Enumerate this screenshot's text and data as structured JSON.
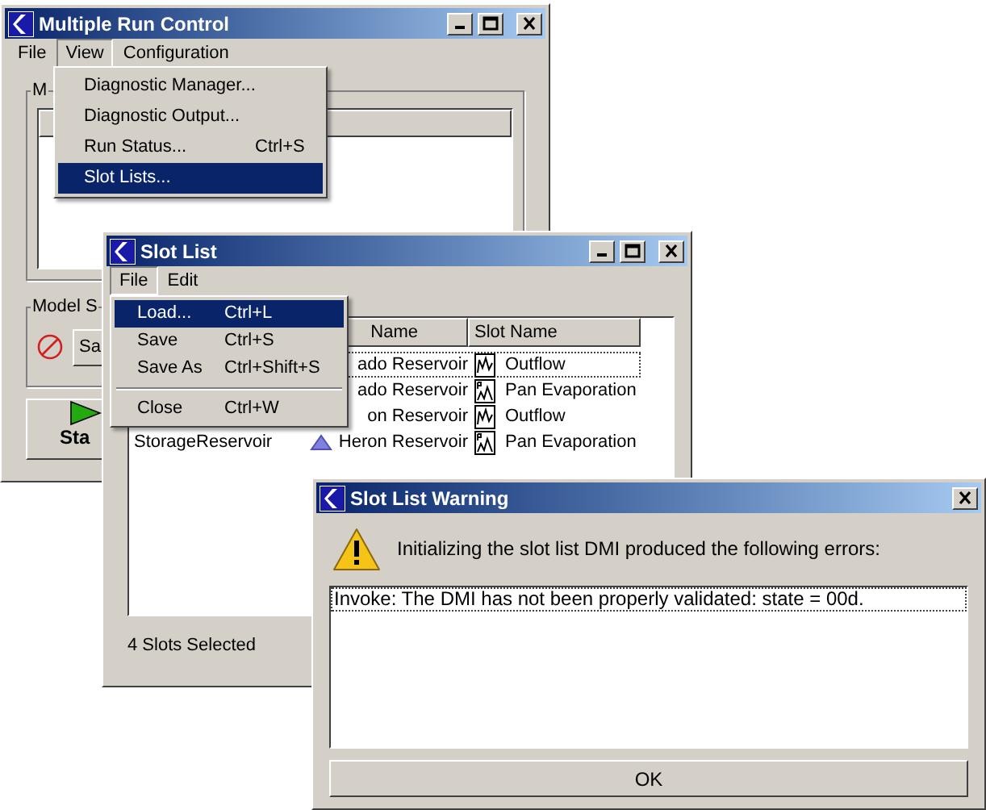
{
  "main_window": {
    "title": "Multiple Run Control",
    "menu": [
      {
        "label": "File",
        "selected": false
      },
      {
        "label": "View",
        "selected": true
      },
      {
        "label": "Configuration",
        "selected": false
      }
    ],
    "view_menu": [
      {
        "label": "Diagnostic Manager...",
        "selected": false
      },
      {
        "label": "Diagnostic Output...",
        "selected": false
      },
      {
        "label": "Run Status...",
        "shortcut": "Ctrl+S",
        "selected": false
      },
      {
        "label": "Slot Lists...",
        "selected": true
      }
    ],
    "group_1": {
      "title": "M"
    },
    "group_2": {
      "title": "Model S",
      "button": "Sa"
    },
    "start_button": "Sta"
  },
  "slot_list_window": {
    "title": "Slot List",
    "menu": [
      {
        "label": "File",
        "selected": true
      },
      {
        "label": "Edit",
        "selected": false
      }
    ],
    "file_menu": [
      {
        "kind": "item",
        "label": "Load...",
        "shortcut": "Ctrl+L",
        "selected": true
      },
      {
        "kind": "item",
        "label": "Save",
        "shortcut": "Ctrl+S",
        "selected": false
      },
      {
        "kind": "item",
        "label": "Save As",
        "shortcut": "Ctrl+Shift+S",
        "selected": false
      },
      {
        "kind": "separator"
      },
      {
        "kind": "item",
        "label": "Close",
        "shortcut": "Ctrl+W",
        "selected": false
      }
    ],
    "table": {
      "columns": [
        "Name",
        "Slot Name"
      ],
      "rows": [
        {
          "object": "ado Reservoir",
          "object_icon": false,
          "kind": "series",
          "slot": "Outflow",
          "focused": true
        },
        {
          "object": "ado Reservoir",
          "object_icon": false,
          "kind": "periodic",
          "slot": "Pan Evaporation",
          "focused": false
        },
        {
          "object": "on Reservoir",
          "object_icon": false,
          "kind": "series",
          "slot": "Outflow",
          "focused": false
        },
        {
          "column_1": "StorageReservoir",
          "object": "Heron Reservoir",
          "object_icon": true,
          "kind": "periodic",
          "slot": "Pan Evaporation",
          "focused": false
        }
      ]
    },
    "status": "4 Slots Selected"
  },
  "warning_dialog": {
    "title": "Slot List Warning",
    "message": "Initializing the slot list DMI produced the following errors:",
    "errors": [
      {
        "text": "Invoke: The DMI has not been properly validated: state = 00d.",
        "focused": true
      }
    ],
    "ok_button": "OK"
  }
}
